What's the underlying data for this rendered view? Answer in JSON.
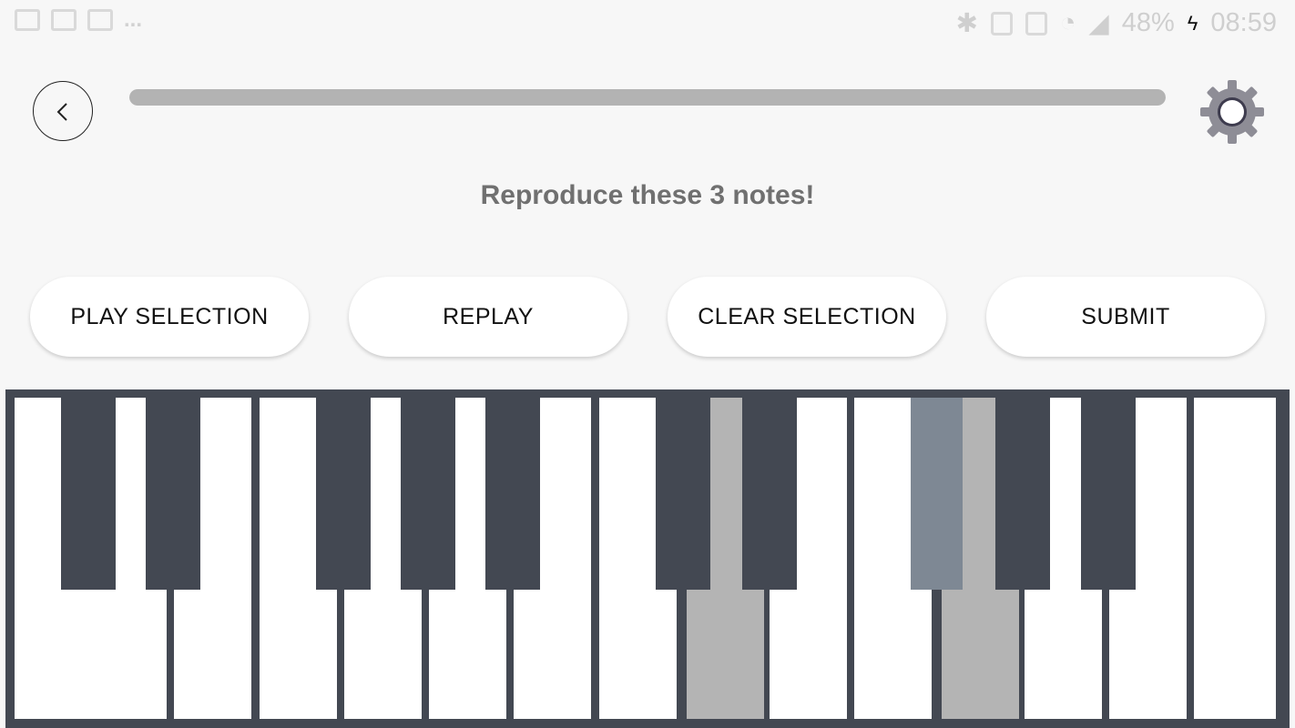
{
  "status_bar": {
    "battery": "48%",
    "time": "08:59"
  },
  "header": {
    "back_icon": "chevron-left-icon",
    "settings_icon": "gear-icon",
    "progress": 1.0
  },
  "prompt": "Reproduce these 3 notes!",
  "buttons": {
    "play_selection": "PLAY SELECTION",
    "replay": "REPLAY",
    "clear_selection": "CLEAR SELECTION",
    "submit": "SUBMIT"
  },
  "piano": {
    "white_keys": 15,
    "selected_white": [
      8,
      11
    ],
    "selected_black": [
      7
    ],
    "colors": {
      "frame": "#434852",
      "selected_white": "#b4b4b4",
      "selected_black": "#7e8894"
    }
  }
}
